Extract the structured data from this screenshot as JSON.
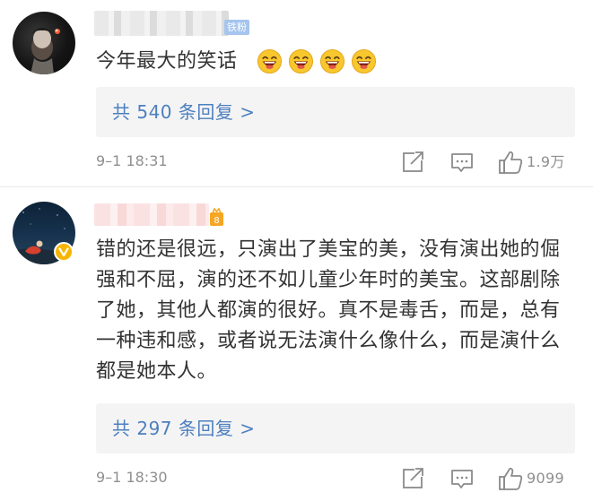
{
  "comments": [
    {
      "badge": "铁粉",
      "text": "今年最大的笑话",
      "emoji_count_icons": [
        "laughing-emoji",
        "laughing-emoji",
        "laughing-emoji",
        "laughing-emoji"
      ],
      "reply_link": "共 540 条回复 >",
      "timestamp": "9–1 18:31",
      "like_count": "1.9万"
    },
    {
      "text": "错的还是很远，只演出了美宝的美，没有演出她的倔强和不屈，演的还不如儿童少年时的美宝。这部剧除了她，其他人都演的很好。真不是毒舌，而是，总有一种违和感，或者说无法演什么像什么，而是演什么都是她本人。",
      "reply_link": "共 297 条回复 >",
      "timestamp": "9–1 18:30",
      "like_count": "9099"
    }
  ],
  "colors": {
    "link": "#4d7fbf",
    "meta": "#8f8f8f",
    "text": "#333333",
    "reply_bg": "#f4f4f4",
    "fan_badge": "#a5c4ee",
    "vip": "#f7b500"
  },
  "icons": {
    "share": "share-icon",
    "comment": "comment-icon",
    "like": "thumbs-up-icon"
  }
}
